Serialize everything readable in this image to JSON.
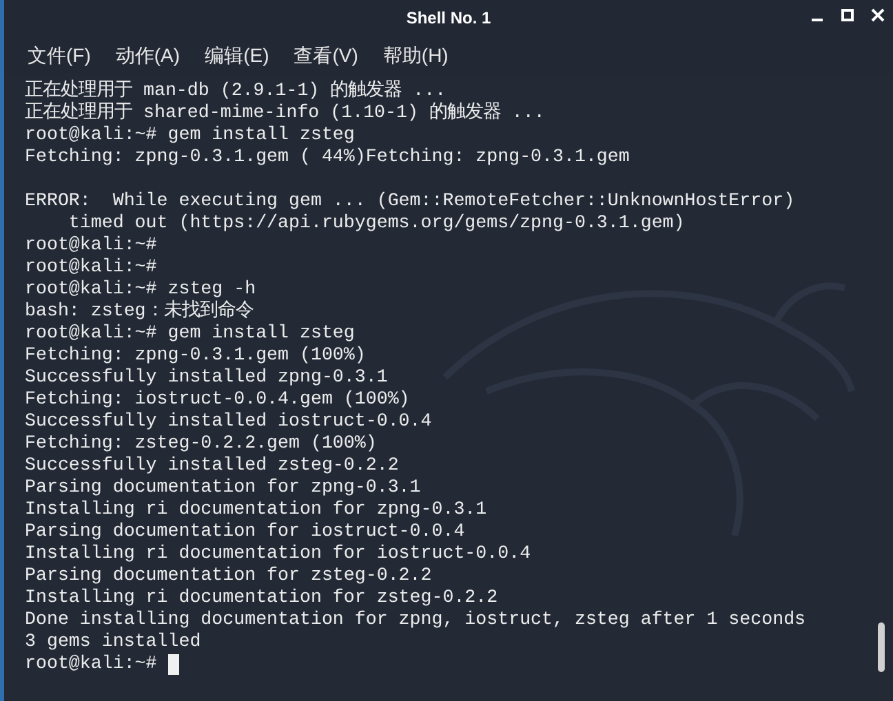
{
  "window": {
    "title": "Shell No. 1"
  },
  "menu": [
    "文件(F)",
    "动作(A)",
    "编辑(E)",
    "查看(V)",
    "帮助(H)"
  ],
  "terminal": {
    "lines": [
      {
        "kind": "text",
        "text": "正在处理用于 man-db (2.9.1-1) 的触发器 ..."
      },
      {
        "kind": "text",
        "text": "正在处理用于 shared-mime-info (1.10-1) 的触发器 ..."
      },
      {
        "kind": "text",
        "text": "root@kali:~# gem install zsteg"
      },
      {
        "kind": "text",
        "text": "Fetching: zpng-0.3.1.gem ( 44%)Fetching: zpng-0.3.1.gem"
      },
      {
        "kind": "blank"
      },
      {
        "kind": "text",
        "text": "ERROR:  While executing gem ... (Gem::RemoteFetcher::UnknownHostError)"
      },
      {
        "kind": "text",
        "text": "    timed out (https://api.rubygems.org/gems/zpng-0.3.1.gem)"
      },
      {
        "kind": "text",
        "text": "root@kali:~#"
      },
      {
        "kind": "text",
        "text": "root@kali:~#"
      },
      {
        "kind": "text",
        "text": "root@kali:~# zsteg -h"
      },
      {
        "kind": "text",
        "text": "bash: zsteg：未找到命令"
      },
      {
        "kind": "text",
        "text": "root@kali:~# gem install zsteg"
      },
      {
        "kind": "text",
        "text": "Fetching: zpng-0.3.1.gem (100%)"
      },
      {
        "kind": "text",
        "text": "Successfully installed zpng-0.3.1"
      },
      {
        "kind": "text",
        "text": "Fetching: iostruct-0.0.4.gem (100%)"
      },
      {
        "kind": "text",
        "text": "Successfully installed iostruct-0.0.4"
      },
      {
        "kind": "text",
        "text": "Fetching: zsteg-0.2.2.gem (100%)"
      },
      {
        "kind": "text",
        "text": "Successfully installed zsteg-0.2.2"
      },
      {
        "kind": "text",
        "text": "Parsing documentation for zpng-0.3.1"
      },
      {
        "kind": "text",
        "text": "Installing ri documentation for zpng-0.3.1"
      },
      {
        "kind": "text",
        "text": "Parsing documentation for iostruct-0.0.4"
      },
      {
        "kind": "text",
        "text": "Installing ri documentation for iostruct-0.0.4"
      },
      {
        "kind": "text",
        "text": "Parsing documentation for zsteg-0.2.2"
      },
      {
        "kind": "text",
        "text": "Installing ri documentation for zsteg-0.2.2"
      },
      {
        "kind": "text",
        "text": "Done installing documentation for zpng, iostruct, zsteg after 1 seconds"
      },
      {
        "kind": "text",
        "text": "3 gems installed"
      },
      {
        "kind": "prompt",
        "text": "root@kali:~#",
        "cursor": true
      }
    ]
  }
}
